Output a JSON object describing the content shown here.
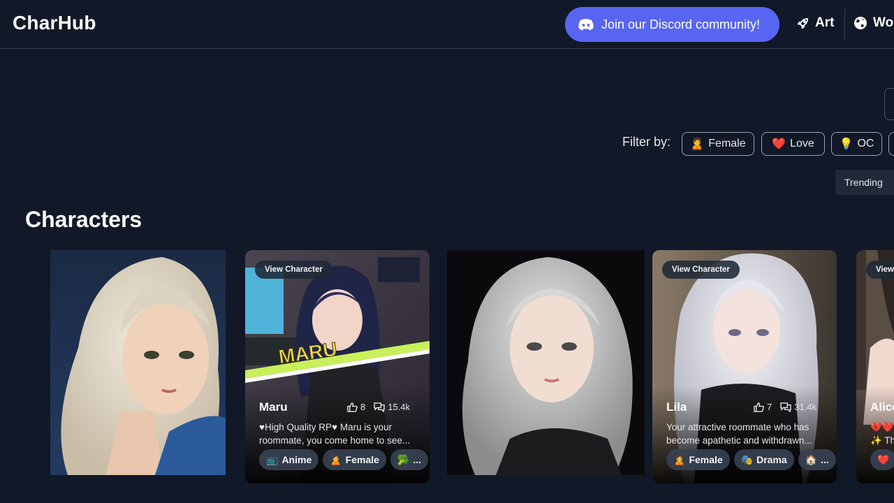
{
  "header": {
    "logo": "CharHub",
    "discord_label": "Join our Discord community!",
    "nav": [
      {
        "label": "Art",
        "icon": "rocket-icon"
      },
      {
        "label": "Wo",
        "icon": "globe-icon"
      }
    ]
  },
  "filters": {
    "label": "Filter by:",
    "chips": [
      {
        "emoji": "🙎",
        "label": "Female"
      },
      {
        "emoji": "❤️",
        "label": "Love"
      },
      {
        "emoji": "💡",
        "label": "OC"
      }
    ],
    "sort_option": "Trending"
  },
  "section_title": "Characters",
  "cards": [
    {
      "name": "",
      "image": "portrait-blonde-wavy-hair"
    },
    {
      "view_label": "View Character",
      "name": "Maru",
      "likes": "8",
      "chats": "15.4k",
      "desc_line1": "♥High Quality RP♥ Maru is your",
      "desc_line2": "roommate, you come home to see...",
      "tags": [
        {
          "emoji": "📺",
          "label": "Anime"
        },
        {
          "emoji": "🙎",
          "label": "Female"
        },
        {
          "emoji": "🥦",
          "label": "..."
        }
      ],
      "image": "anime-girl-gaming-room",
      "image_text": "MARU"
    },
    {
      "name": "",
      "image": "portrait-silver-hair"
    },
    {
      "view_label": "View Character",
      "name": "Lila",
      "likes": "7",
      "chats": "31.4k",
      "desc_line1": "Your attractive roommate who has",
      "desc_line2": "become apathetic and withdrawn...",
      "tags": [
        {
          "emoji": "🙎",
          "label": "Female"
        },
        {
          "emoji": "🎭",
          "label": "Drama"
        },
        {
          "emoji": "🏠",
          "label": "..."
        }
      ],
      "image": "anime-girl-white-hair"
    },
    {
      "view_label": "View",
      "name": "Alice",
      "desc_line1": "💔❤️",
      "desc_line2": "✨ Th",
      "tags": [
        {
          "emoji": "❤️",
          "label": ""
        }
      ],
      "image": "anime-girl-partial"
    }
  ],
  "colors": {
    "background": "#111827",
    "discord": "#5865f2",
    "border": "#374151",
    "chip_border": "#9ca3af"
  }
}
